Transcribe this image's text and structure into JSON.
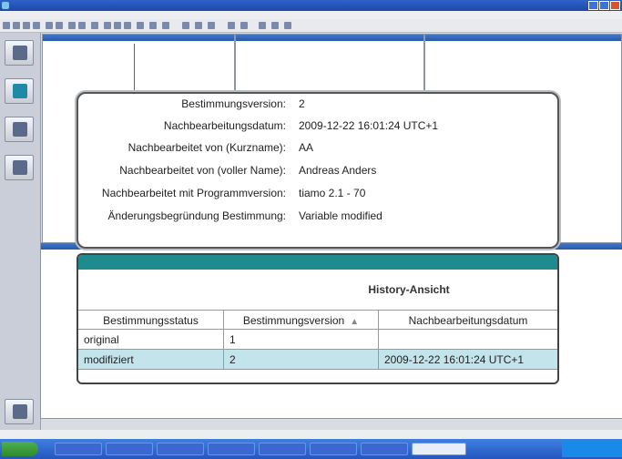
{
  "detail": {
    "rows": [
      {
        "label": "Bestimmungsversion:",
        "value": "2"
      },
      {
        "label": "Nachbearbeitungsdatum:",
        "value": "2009-12-22 16:01:24 UTC+1"
      },
      {
        "label": "Nachbearbeitet von (Kurzname):",
        "value": "AA"
      },
      {
        "label": "Nachbearbeitet von (voller Name):",
        "value": "Andreas Anders"
      },
      {
        "label": "Nachbearbeitet mit Programmversion:",
        "value": "tiamo 2.1 - 70"
      },
      {
        "label": "Änderungsbegründung Bestimmung:",
        "value": "Variable modified"
      }
    ]
  },
  "history": {
    "title": "History-Ansicht",
    "columns": [
      "Bestimmungsstatus",
      "Bestimmungsversion",
      "Nachbearbeitungsdatum"
    ],
    "rows": [
      {
        "status": "original",
        "version": "1",
        "date": ""
      },
      {
        "status": "modifiziert",
        "version": "2",
        "date": "2009-12-22 16:01:24 UTC+1"
      }
    ]
  },
  "icons": {
    "sort": "sort-ascending-icon"
  }
}
